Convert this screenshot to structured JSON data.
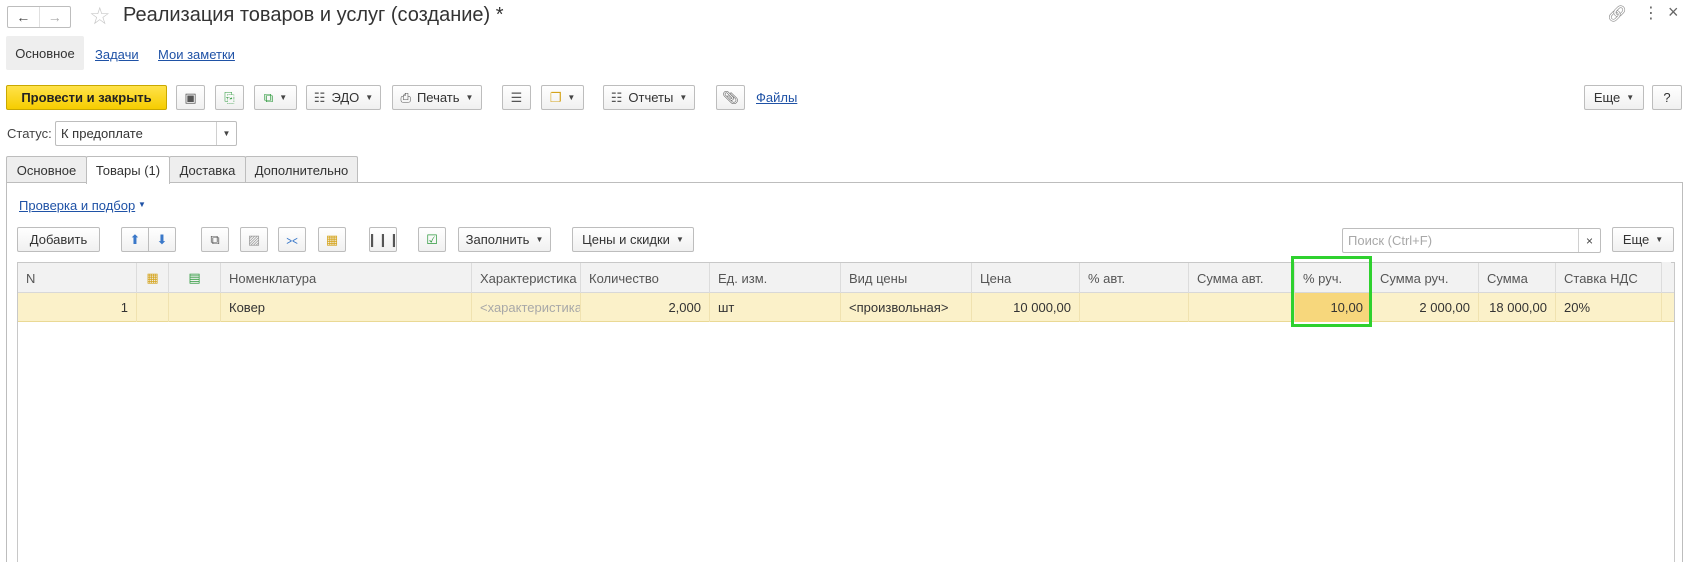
{
  "window": {
    "title": "Реализация товаров и услуг (создание) *",
    "back_icon": "arrow-left-icon",
    "forward_icon": "arrow-right-icon",
    "favorite_icon": "star-icon",
    "link_icon": "link-icon",
    "more_icon": "kebab-menu-icon",
    "close_icon": "close-icon"
  },
  "section_nav": {
    "active": "Основное",
    "links": [
      "Задачи",
      "Мои заметки"
    ]
  },
  "toolbar": {
    "post_close": "Провести и закрыть",
    "edo": "ЭДО",
    "print": "Печать",
    "reports": "Отчеты",
    "files": "Файлы",
    "more": "Еще",
    "help": "?"
  },
  "status": {
    "label": "Статус:",
    "value": "К предоплате"
  },
  "tabs": [
    "Основное",
    "Товары (1)",
    "Доставка",
    "Дополнительно"
  ],
  "active_tab": "Товары (1)",
  "goods": {
    "check_link": "Проверка и подбор",
    "add": "Добавить",
    "fill": "Заполнить",
    "prices": "Цены и скидки",
    "search_placeholder": "Поиск (Ctrl+F)",
    "search_clear": "×",
    "more": "Еще"
  },
  "table": {
    "columns": [
      "N",
      "",
      "",
      "Номенклатура",
      "Характеристика",
      "Количество",
      "Ед. изм.",
      "Вид цены",
      "Цена",
      "% авт.",
      "Сумма авт.",
      "% руч.",
      "Сумма руч.",
      "Сумма",
      "Ставка НДС"
    ],
    "rows": [
      {
        "n": "1",
        "nomenclature": "Ковер",
        "characteristic": "<характеристика>",
        "quantity": "2,000",
        "unit": "шт",
        "price_type": "<произвольная>",
        "price": "10 000,00",
        "auto_pct": "",
        "auto_sum": "",
        "manual_pct": "10,00",
        "manual_sum": "2 000,00",
        "sum": "18 000,00",
        "vat_rate": "20%"
      }
    ]
  },
  "colors": {
    "primary_button": "#f6cd00",
    "row_highlight": "#fbf1c9",
    "selected_cell": "#f7d77c",
    "focus_outline": "#2ed12e",
    "link": "#1f52a6"
  }
}
